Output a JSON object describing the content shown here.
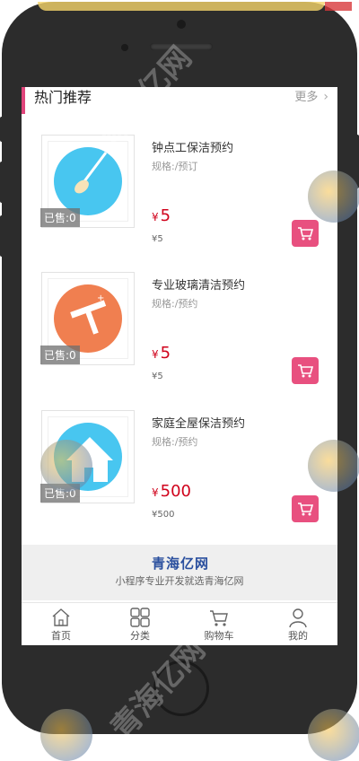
{
  "section": {
    "title": "热门推荐",
    "more_label": "更多",
    "more_arrow": "›"
  },
  "products": [
    {
      "name": "钟点工保洁预约",
      "spec": "规格:/预订",
      "sold": "已售:0",
      "currency": "¥",
      "price": "5",
      "original_price": "¥5",
      "image_icon": "broom-icon",
      "image_color": "#48c6f0"
    },
    {
      "name": "专业玻璃清洁预约",
      "spec": "规格:/预约",
      "sold": "已售:0",
      "currency": "¥",
      "price": "5",
      "original_price": "¥5",
      "image_icon": "squeegee-icon",
      "image_color": "#f07f50"
    },
    {
      "name": "家庭全屋保洁预约",
      "spec": "规格:/预约",
      "sold": "已售:0",
      "currency": "¥",
      "price": "500",
      "original_price": "¥500",
      "image_icon": "house-icon",
      "image_color": "#48c6f0"
    }
  ],
  "footer": {
    "brand": "青海亿网",
    "tagline": "小程序专业开发就选青海亿网"
  },
  "tabs": [
    {
      "label": "首页",
      "icon": "home-icon"
    },
    {
      "label": "分类",
      "icon": "grid-icon"
    },
    {
      "label": "购物车",
      "icon": "cart-icon"
    },
    {
      "label": "我的",
      "icon": "user-icon"
    }
  ],
  "watermark": {
    "text": "青海亿网"
  },
  "colors": {
    "accent": "#e8507f",
    "price": "#d0021b",
    "brand": "#2a4f9e"
  }
}
